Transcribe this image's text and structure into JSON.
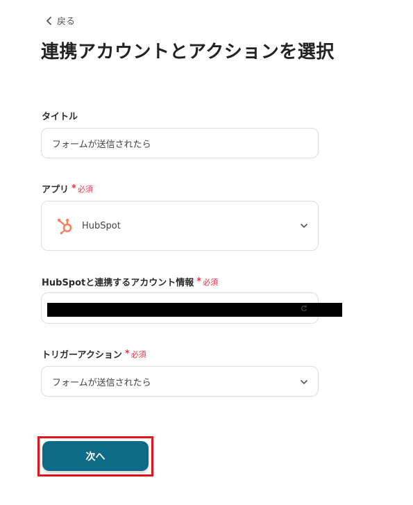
{
  "back": {
    "label": "戻る"
  },
  "page_title": "連携アカウントとアクションを選択",
  "fields": {
    "title": {
      "label": "タイトル",
      "value": "フォームが送信されたら"
    },
    "app": {
      "label": "アプリ",
      "required_mark": "*",
      "required_text": "必須",
      "value": "HubSpot",
      "icon": "hubspot-icon"
    },
    "account": {
      "label": "HubSpotと連携するアカウント情報",
      "required_mark": "*",
      "required_text": "必須",
      "value_redacted": true
    },
    "trigger": {
      "label": "トリガーアクション",
      "required_mark": "*",
      "required_text": "必須",
      "value": "フォームが送信されたら"
    }
  },
  "next_button": {
    "label": "次へ"
  },
  "colors": {
    "primary": "#0d6b85",
    "required": "#e3344a",
    "hubspot": "#ff7a59",
    "highlight": "#e0141f",
    "border": "#d9dde2"
  }
}
